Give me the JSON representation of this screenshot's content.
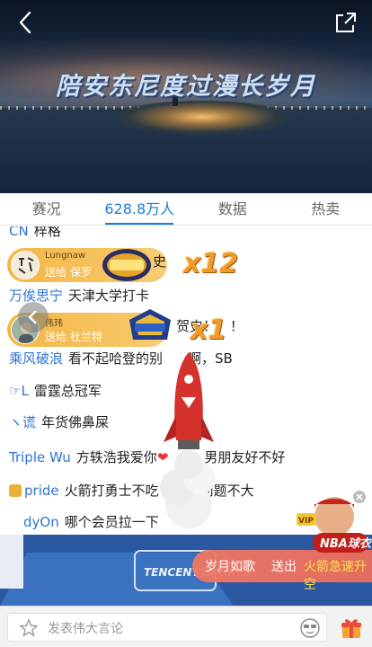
{
  "video": {
    "caption": "陪安东尼度过漫长岁月"
  },
  "tabs": [
    {
      "label": "赛况"
    },
    {
      "label": "628.8万人",
      "active": true
    },
    {
      "label": "数据"
    },
    {
      "label": "热卖"
    }
  ],
  "chat": {
    "messages": [
      {
        "user": "CN",
        "text": "梓格"
      },
      {
        "user": "万俟思宁",
        "text": "天津大学打卡"
      },
      {
        "user": "",
        "text": "贺史！！！"
      },
      {
        "user": "乘风破浪",
        "text": "看不起哈登的别",
        "text2": "啊，SB"
      },
      {
        "user": "☞L",
        "text": "雷霆总冠军"
      },
      {
        "user": "ヽ谎",
        "text": "年货佛鼻屎"
      },
      {
        "user": "Triple Wu",
        "text": "方轶浩我爱你",
        "text2": "男朋友好不好"
      },
      {
        "user": "pride",
        "text": "火箭打勇士不吃",
        "text2": "问题不大"
      },
      {
        "user": "dyOn",
        "text": "哪个会员拉一下"
      }
    ],
    "gifts": [
      {
        "sender": "Lungnaw",
        "action": "送给",
        "receiver": "保罗",
        "item": "三连",
        "count": "x12",
        "extra": "史"
      },
      {
        "sender": "伟玮",
        "action": "送给",
        "receiver": "杜兰特",
        "item": "火箭",
        "count": "x1"
      }
    ]
  },
  "fan_card": {
    "who": "岁月如歌",
    "action": "送出",
    "item": "火箭急速升空",
    "badge": "NBA球衣",
    "vip": "VIP"
  },
  "court": {
    "logo": "TENCENT SPORTS"
  },
  "input": {
    "placeholder": "发表伟大言论"
  },
  "colors": {
    "accent": "#1a7ddb",
    "username": "#2e73d6",
    "gift_bubble": "#f4b648",
    "gift_count": "#f19a2a"
  }
}
